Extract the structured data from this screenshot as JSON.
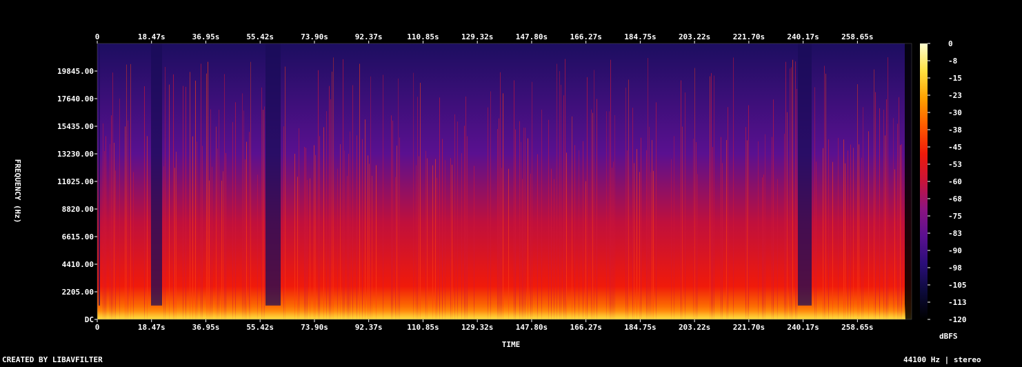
{
  "chart_data": {
    "type": "heatmap",
    "title": "",
    "xlabel": "TIME",
    "ylabel": "FREQUENCY (Hz)",
    "x_ticks": [
      "0",
      "18.47s",
      "36.95s",
      "55.42s",
      "73.90s",
      "92.37s",
      "110.85s",
      "129.32s",
      "147.80s",
      "166.27s",
      "184.75s",
      "203.22s",
      "221.70s",
      "240.17s",
      "258.65s"
    ],
    "x_tick_values": [
      0,
      18.47,
      36.95,
      55.42,
      73.9,
      92.37,
      110.85,
      129.32,
      147.8,
      166.27,
      184.75,
      203.22,
      221.7,
      240.17,
      258.65
    ],
    "xlim": [
      0,
      277.1
    ],
    "y_ticks": [
      "19845.00",
      "17640.00",
      "15435.00",
      "13230.00",
      "11025.00",
      "8820.00",
      "6615.00",
      "4410.00",
      "2205.00",
      "DC"
    ],
    "y_tick_values": [
      19845,
      17640,
      15435,
      13230,
      11025,
      8820,
      6615,
      4410,
      2205,
      0
    ],
    "ylim": [
      0,
      22050
    ],
    "colorbar": {
      "label": "dBFS",
      "ticks": [
        "0",
        "-8",
        "-15",
        "-23",
        "-30",
        "-38",
        "-45",
        "-53",
        "-60",
        "-68",
        "-75",
        "-83",
        "-90",
        "-98",
        "-105",
        "-113",
        "-120"
      ],
      "range": [
        -120,
        0
      ],
      "colormap": [
        "#000000",
        "#0c0a3a",
        "#2a0e78",
        "#5a1090",
        "#8c1480",
        "#c8143a",
        "#f01a0a",
        "#ff5a00",
        "#ffa000",
        "#ffe040",
        "#ffffd0"
      ]
    },
    "grid": false
  },
  "footer": {
    "credit": "CREATED BY LIBAVFILTER",
    "format": "44100 Hz | stereo"
  }
}
